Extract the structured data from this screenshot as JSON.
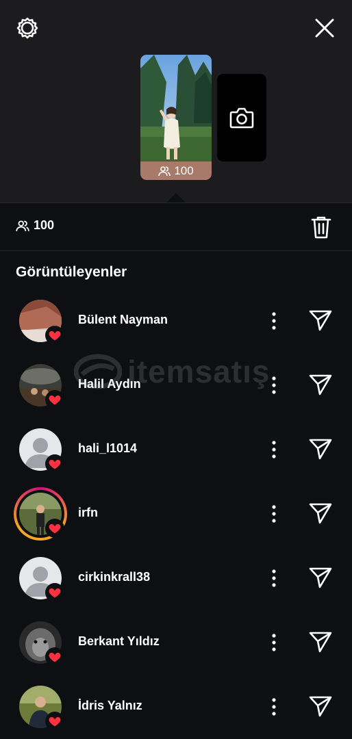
{
  "icons": {
    "settings": "gear-icon",
    "close": "close-icon",
    "camera": "camera-icon",
    "viewers": "people-icon",
    "delete": "trash-icon",
    "more": "more-vertical-icon",
    "send": "send-icon",
    "like": "heart-icon"
  },
  "colors": {
    "background": "#0d0f13",
    "header_background": "#1c1c1e",
    "heart": "#ff3040",
    "thumb_bar": "#a87a69"
  },
  "story": {
    "thumbnail_view_count": "100"
  },
  "stats": {
    "view_count": "100"
  },
  "section_title": "Görüntüleyenler",
  "watermark": "itemsatış",
  "viewers": [
    {
      "name": "Bülent Nayman",
      "liked": true,
      "story_ring": false
    },
    {
      "name": "Halil Aydın",
      "liked": true,
      "story_ring": false
    },
    {
      "name": "hali_l1014",
      "liked": true,
      "story_ring": false
    },
    {
      "name": "irfn",
      "liked": true,
      "story_ring": true
    },
    {
      "name": "cirkinkrall38",
      "liked": true,
      "story_ring": false
    },
    {
      "name": "Berkant Yıldız",
      "liked": true,
      "story_ring": false
    },
    {
      "name": "İdris Yalnız",
      "liked": true,
      "story_ring": false
    }
  ]
}
